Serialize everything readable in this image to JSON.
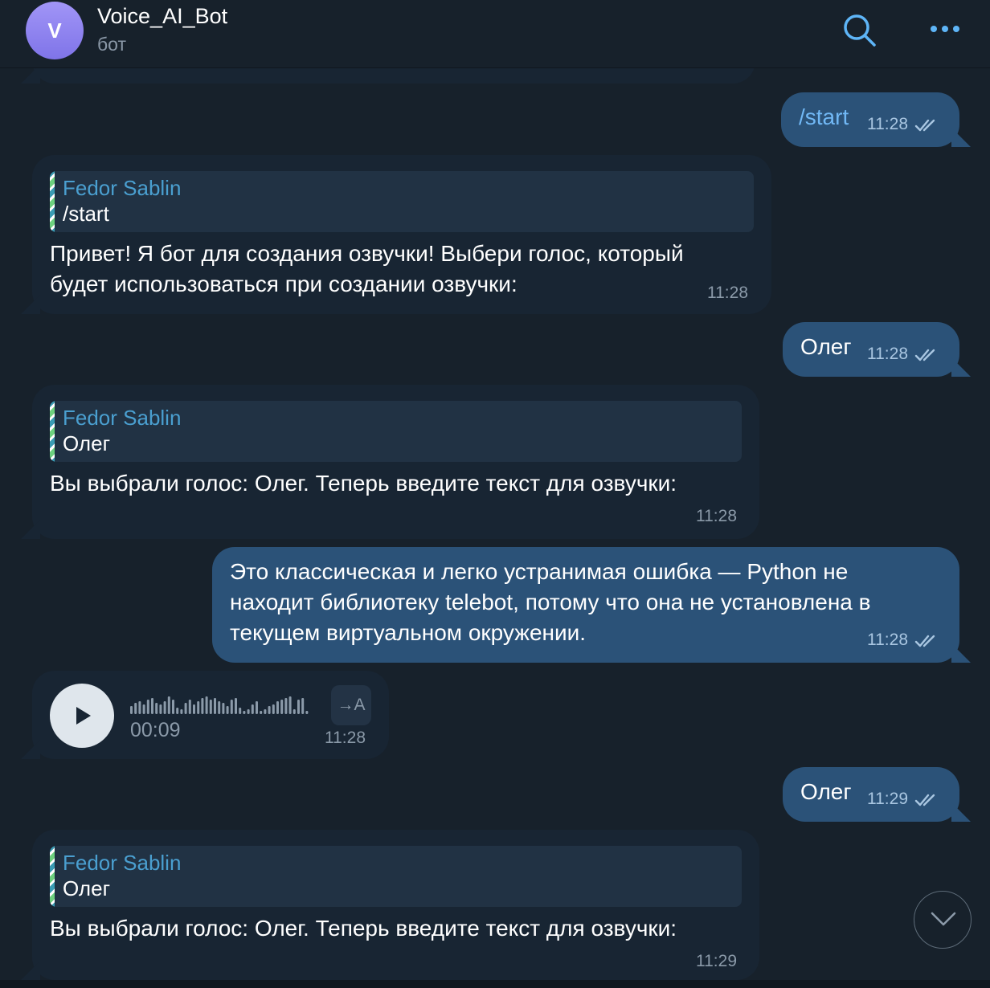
{
  "header": {
    "avatar_letter": "V",
    "title": "Voice_AI_Bot",
    "subtitle": "бот",
    "icons": [
      "search-icon",
      "more-icon"
    ],
    "accent_color": "#5eb5f7"
  },
  "messages": {
    "m1": {
      "text": "/start",
      "time": "11:28"
    },
    "m2": {
      "reply_author": "Fedor Sablin",
      "reply_text": "/start",
      "line1": "Привет! Я бот для создания озвучки! Выбери голос, который",
      "line2": "будет использоваться при создании озвучки:",
      "time": "11:28"
    },
    "m3": {
      "text": "Олег",
      "time": "11:28"
    },
    "m4": {
      "reply_author": "Fedor Sablin",
      "reply_text": "Олег",
      "text": "Вы выбрали голос: Олег. Теперь введите текст для озвучки:",
      "time": "11:28"
    },
    "m5": {
      "line1": "Это классическая и легко устранимая ошибка — Python не",
      "line2": "находит библиотеку telebot, потому что она не установлена в",
      "line3": "текущем виртуальном окружении.",
      "time": "11:28"
    },
    "m6": {
      "duration": "00:09",
      "transcribe": "→A",
      "time": "11:28"
    },
    "m7": {
      "text": "Олег",
      "time": "11:29"
    },
    "m8": {
      "reply_author": "Fedor Sablin",
      "reply_text": "Олег",
      "text": "Вы выбрали голос: Олег. Теперь введите текст для озвучки:",
      "time": "11:29"
    }
  },
  "colors": {
    "background": "#17212b",
    "incoming_bubble": "#182533",
    "outgoing_bubble": "#2b5278",
    "reply_name": "#4a9fd0"
  }
}
